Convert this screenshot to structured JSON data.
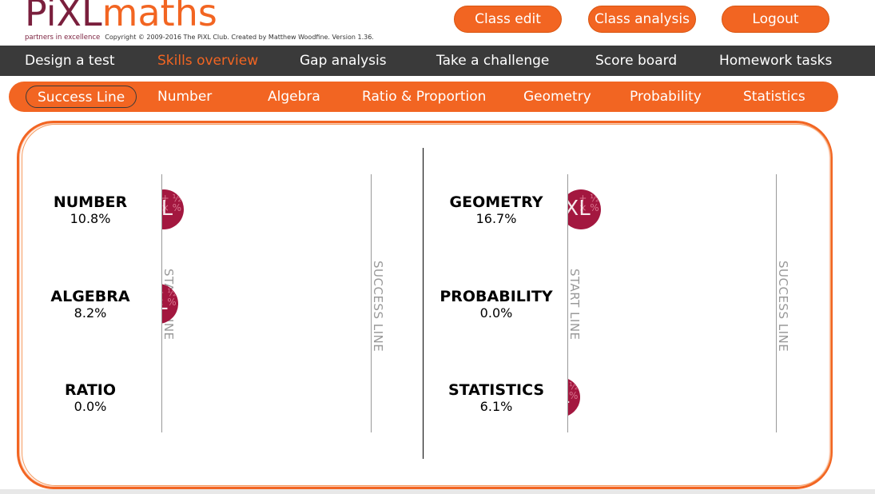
{
  "brand": {
    "logo_pixl": "PiXL",
    "logo_maths": "maths",
    "tagline": "partners in excellence",
    "copyright": "Copyright © 2009-2016 The PiXL Club. Created by Matthew Woodfine. Version 1.36.",
    "primary_color": "#f26522",
    "accent_color": "#7a1f3d"
  },
  "top_buttons": {
    "class_edit": "Class edit",
    "class_analysis": "Class analysis",
    "logout": "Logout"
  },
  "main_nav": {
    "items": [
      "Design a test",
      "Skills overview",
      "Gap analysis",
      "Take a challenge",
      "Score board",
      "Homework tasks"
    ],
    "active": "Skills overview"
  },
  "sub_nav": {
    "items": [
      "Success Line",
      "Number",
      "Algebra",
      "Ratio & Proportion",
      "Geometry",
      "Probability",
      "Statistics"
    ],
    "active": "Success Line"
  },
  "chart": {
    "start_label": "START LINE",
    "success_label": "SUCCESS LINE",
    "marker_icon": "pixl-ball-icon",
    "marker_text": "XL",
    "left": [
      {
        "name": "NUMBER",
        "percent": "10.8%",
        "value": 10.8
      },
      {
        "name": "ALGEBRA",
        "percent": "8.2%",
        "value": 8.2
      },
      {
        "name": "RATIO",
        "percent": "0.0%",
        "value": 0.0
      }
    ],
    "right": [
      {
        "name": "GEOMETRY",
        "percent": "16.7%",
        "value": 16.7
      },
      {
        "name": "PROBABILITY",
        "percent": "0.0%",
        "value": 0.0
      },
      {
        "name": "STATISTICS",
        "percent": "6.1%",
        "value": 6.1
      }
    ]
  }
}
